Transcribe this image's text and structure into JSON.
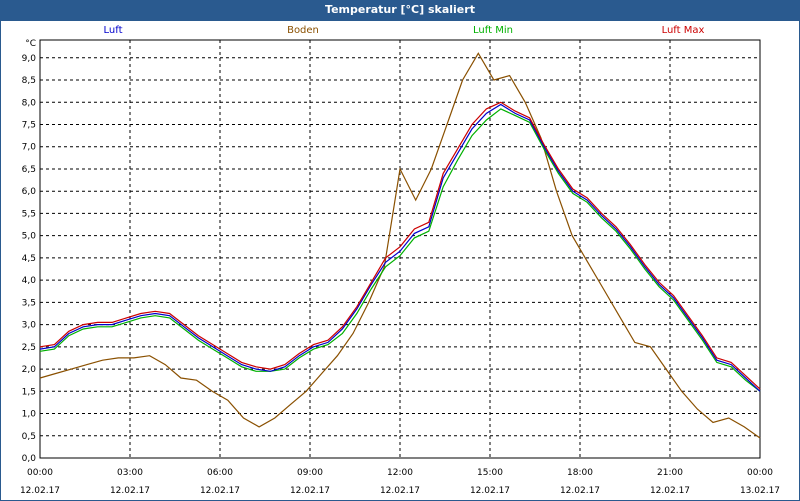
{
  "window": {
    "title": "Temperatur [°C] skaliert"
  },
  "colors": {
    "title_bar": "#2a5a8f",
    "luft": "#0000cc",
    "boden": "#8a5000",
    "luft_min": "#00b000",
    "luft_max": "#cc0000"
  },
  "chart_data": {
    "type": "line",
    "title": "Temperatur [°C] skaliert",
    "ylabel": "°C",
    "xlabel": "",
    "grid": true,
    "legend_placement": "top",
    "ylim": [
      0,
      9.4
    ],
    "xlim": [
      0,
      24
    ],
    "yticks": [
      "0,0",
      "0,5",
      "1,0",
      "1,5",
      "2,0",
      "2,5",
      "3,0",
      "3,5",
      "4,0",
      "4,5",
      "5,0",
      "5,5",
      "6,0",
      "6,5",
      "7,0",
      "7,5",
      "8,0",
      "8,5",
      "9,0"
    ],
    "xticks": [
      {
        "time": "00:00",
        "date": "12.02.17"
      },
      {
        "time": "03:00",
        "date": "12.02.17"
      },
      {
        "time": "06:00",
        "date": "12.02.17"
      },
      {
        "time": "09:00",
        "date": "12.02.17"
      },
      {
        "time": "12:00",
        "date": "12.02.17"
      },
      {
        "time": "15:00",
        "date": "12.02.17"
      },
      {
        "time": "18:00",
        "date": "12.02.17"
      },
      {
        "time": "21:00",
        "date": "12.02.17"
      },
      {
        "time": "00:00",
        "date": "13.02.17"
      }
    ],
    "x": [
      0,
      0.5,
      1,
      1.5,
      2,
      2.5,
      3,
      3.5,
      4,
      4.5,
      5,
      5.5,
      6,
      6.5,
      7,
      7.5,
      8,
      8.5,
      9,
      9.5,
      10,
      10.5,
      11,
      11.5,
      12,
      12.5,
      13,
      13.5,
      14,
      14.5,
      15,
      15.5,
      16,
      16.5,
      17,
      17.5,
      18,
      18.5,
      19,
      19.5,
      20,
      20.5,
      21,
      21.5,
      22,
      22.5,
      23,
      23.5,
      24
    ],
    "series": [
      {
        "name": "Luft",
        "color": "#0000cc",
        "values": [
          2.45,
          2.5,
          2.8,
          2.95,
          3.0,
          3.0,
          3.1,
          3.2,
          3.25,
          3.2,
          2.95,
          2.7,
          2.5,
          2.3,
          2.1,
          2.0,
          1.95,
          2.05,
          2.3,
          2.5,
          2.6,
          2.9,
          3.35,
          3.9,
          4.4,
          4.65,
          5.05,
          5.2,
          6.3,
          6.85,
          7.4,
          7.75,
          7.95,
          7.75,
          7.6,
          7.0,
          6.45,
          6.0,
          5.8,
          5.45,
          5.15,
          4.75,
          4.3,
          3.9,
          3.6,
          3.15,
          2.7,
          2.2,
          2.1,
          1.8,
          1.5
        ]
      },
      {
        "name": "Boden",
        "color": "#8a5000",
        "values": [
          1.8,
          1.9,
          2.0,
          2.1,
          2.2,
          2.25,
          2.25,
          2.3,
          2.1,
          1.8,
          1.75,
          1.5,
          1.3,
          0.9,
          0.7,
          0.9,
          1.2,
          1.5,
          1.9,
          2.3,
          2.8,
          3.5,
          4.3,
          6.5,
          5.8,
          6.5,
          7.5,
          8.5,
          9.1,
          8.5,
          8.6,
          8.0,
          7.2,
          6.0,
          5.0,
          4.4,
          3.8,
          3.2,
          2.6,
          2.5,
          2.0,
          1.5,
          1.1,
          0.8,
          0.9,
          0.7,
          0.45
        ]
      },
      {
        "name": "Luft Min",
        "color": "#00b000",
        "values": [
          2.4,
          2.45,
          2.75,
          2.9,
          2.95,
          2.95,
          3.05,
          3.15,
          3.2,
          3.15,
          2.9,
          2.65,
          2.45,
          2.25,
          2.05,
          1.95,
          1.95,
          2.0,
          2.25,
          2.45,
          2.55,
          2.8,
          3.25,
          3.8,
          4.3,
          4.55,
          4.95,
          5.1,
          6.1,
          6.7,
          7.25,
          7.6,
          7.85,
          7.7,
          7.55,
          6.95,
          6.4,
          5.95,
          5.75,
          5.4,
          5.1,
          4.7,
          4.25,
          3.85,
          3.55,
          3.1,
          2.65,
          2.15,
          2.05,
          1.75,
          1.5
        ]
      },
      {
        "name": "Luft Max",
        "color": "#cc0000",
        "values": [
          2.5,
          2.55,
          2.85,
          3.0,
          3.05,
          3.05,
          3.15,
          3.25,
          3.3,
          3.25,
          3.0,
          2.75,
          2.55,
          2.35,
          2.15,
          2.05,
          2.0,
          2.1,
          2.35,
          2.55,
          2.65,
          2.95,
          3.4,
          3.95,
          4.5,
          4.75,
          5.15,
          5.3,
          6.4,
          6.95,
          7.5,
          7.85,
          8.0,
          7.8,
          7.65,
          7.05,
          6.5,
          6.05,
          5.85,
          5.5,
          5.2,
          4.8,
          4.35,
          3.95,
          3.65,
          3.2,
          2.75,
          2.25,
          2.15,
          1.85,
          1.55
        ]
      }
    ]
  }
}
